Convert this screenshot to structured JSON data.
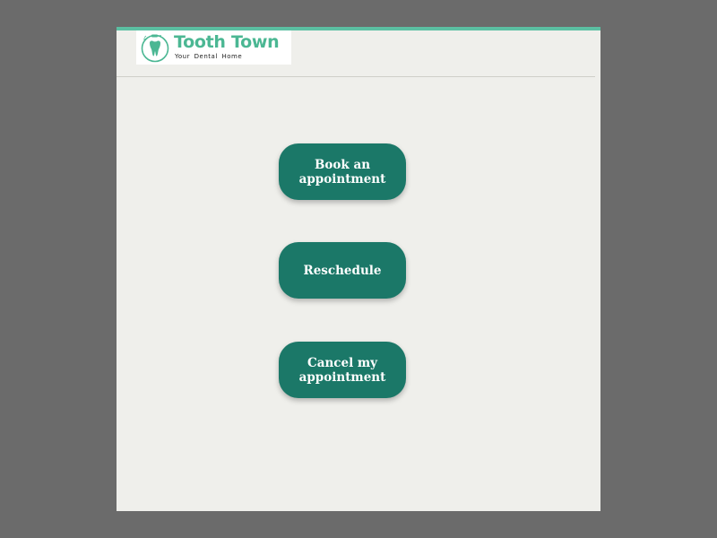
{
  "brand": {
    "name": "Tooth Town",
    "tagline": "Your Dental Home",
    "color": "#4bb793"
  },
  "actions": {
    "book_label": "Book an appointment",
    "reschedule_label": "Reschedule",
    "cancel_label": "Cancel my appointment"
  },
  "colors": {
    "page_background": "#6b6b6b",
    "card_background": "#efefeb",
    "top_accent": "#5bbfa2",
    "button": "#1b7868",
    "button_text": "#ffffff"
  },
  "icons": {
    "logo": "tooth-icon"
  }
}
